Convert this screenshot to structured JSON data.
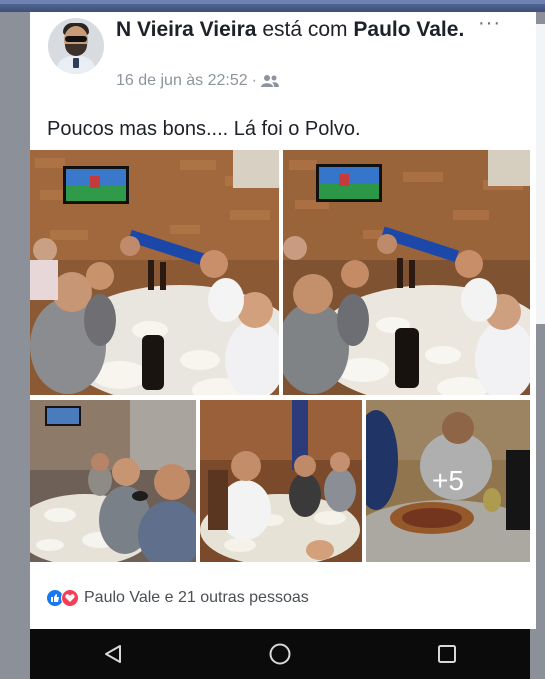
{
  "post": {
    "author": "N Vieira Vieira",
    "with_text": "está com",
    "tagged": "Paulo Vale.",
    "timestamp": "16 de jun às 22:52",
    "separator": "·",
    "audience_icon": "friends-icon",
    "more_label": "···",
    "text": "Poucos mas bons.... Lá foi o Polvo."
  },
  "photos": {
    "more_count": "+5"
  },
  "reactions": {
    "types": [
      "like",
      "love"
    ],
    "summary": "Paulo Vale e 21 outras pessoas"
  },
  "navigation": {
    "back_icon": "triangle-back-icon",
    "home_icon": "circle-home-icon",
    "recents_icon": "square-recents-icon"
  },
  "colors": {
    "facebook_blue": "#3b5998",
    "like_blue": "#1877f2",
    "love_red": "#f33e58",
    "text_gray": "#8d949e"
  }
}
